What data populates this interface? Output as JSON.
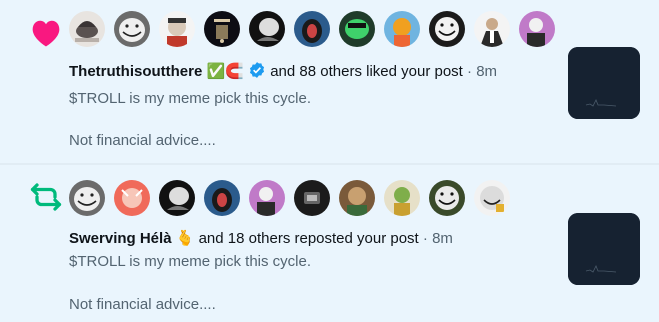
{
  "notifications": [
    {
      "type": "like",
      "icon": "heart-icon",
      "accent": "#f91880",
      "user": "Thetruthisoutthere",
      "user_emoji": "✅🧲",
      "verified": true,
      "action": "and 88 others liked your post",
      "separator": "·",
      "time": "8m",
      "post_line1": "$TROLL  is my meme pick this cycle.",
      "post_line2": "Not financial advice....",
      "avatar_count": 11
    },
    {
      "type": "repost",
      "icon": "repost-icon",
      "accent": "#00ba7c",
      "user": "Swerving Hélà",
      "user_emoji": "🫰",
      "verified": false,
      "action": "and 18 others reposted your post",
      "separator": "·",
      "time": "8m",
      "post_line1": "$TROLL  is my meme pick this cycle.",
      "post_line2": "Not financial advice....",
      "avatar_count": 11
    }
  ],
  "colors": {
    "background": "#eaf5fd",
    "verified_blue": "#1d9bf0",
    "secondary_text": "#536471",
    "thumbnail": "#162231"
  }
}
